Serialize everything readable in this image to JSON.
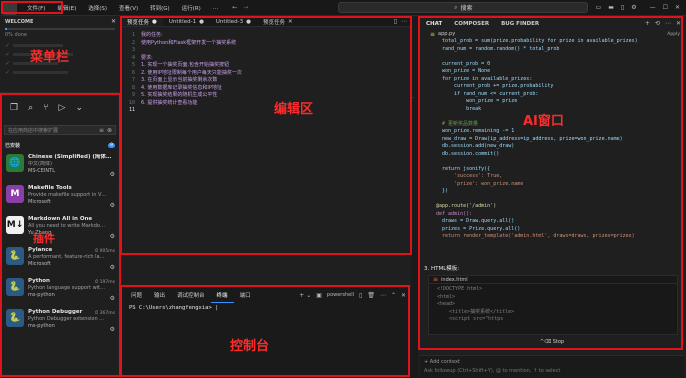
{
  "menu": {
    "items": [
      "文件(F)",
      "编辑(E)",
      "选择(S)",
      "查看(V)",
      "转到(G)",
      "运行(R)",
      "…"
    ],
    "search": "搜索"
  },
  "welcome": {
    "title": "WELCOME",
    "progress_label": "0% done",
    "progress_fraction": 0.0
  },
  "activity": [
    "explorer-icon",
    "search-icon",
    "source-control-icon",
    "run-debug-icon",
    "extensions-icon"
  ],
  "extensions": {
    "search_placeholder": "在应用商店中搜索扩展",
    "section_label": "已安装",
    "badge": "9",
    "items": [
      {
        "title": "Chinese (Simplified) (简体…",
        "desc": "中文(简体)",
        "publisher": "MS-CEINTL",
        "icon": "globe-icon",
        "color": "#2a7a3b",
        "glyph": "🌐",
        "meta": ""
      },
      {
        "title": "Makefile Tools",
        "desc": "Provide makefile support in V…",
        "publisher": "Microsoft",
        "icon": "makefile-icon",
        "color": "#8a3fa8",
        "glyph": "M",
        "meta": ""
      },
      {
        "title": "Markdown All in One",
        "desc": "All you need to write Markdo…",
        "publisher": "Yu Zhang",
        "icon": "markdown-icon",
        "color": "#f0f0f0",
        "glyph": "M↓",
        "meta": ""
      },
      {
        "title": "Pylance",
        "desc": "A performant, feature-rich la…",
        "publisher": "Microsoft",
        "icon": "python-icon",
        "color": "#2b5b84",
        "glyph": "🐍",
        "meta": "⏱ 905ms"
      },
      {
        "title": "Python",
        "desc": "Python language support wit…",
        "publisher": "ms-python",
        "icon": "python-icon",
        "color": "#2b5b84",
        "glyph": "🐍",
        "meta": "⏱ 197ms"
      },
      {
        "title": "Python Debugger",
        "desc": "Python Debugger extension …",
        "publisher": "ms-python",
        "icon": "python-debugger-icon",
        "color": "#2b5b84",
        "glyph": "🐍",
        "meta": "⏱ 367ms"
      }
    ]
  },
  "editor": {
    "tabs": [
      {
        "label": "预览任务",
        "dot": true
      },
      {
        "label": "Untitled-1",
        "dot": true
      },
      {
        "label": "Untitled-3",
        "dot": true
      },
      {
        "label": "预览任务",
        "dot": false
      }
    ],
    "lines": [
      "我的任务:",
      "使用Python和Flask框架开发一个抽奖系统",
      "",
      "要求:",
      "1. 实现一个抽奖页面,包含开始抽奖按钮",
      "2. 使用IP地址限制每个用户每天只能抽奖一次",
      "3. 在页面上显示当前抽奖剩余次数",
      "4. 使用数据库记录抽奖信息和IP地址",
      "5. 实现抽奖结果的随机生成公平性",
      "6. 提供抽奖统计查看功能",
      ""
    ]
  },
  "panel": {
    "tabs": [
      "问题",
      "输出",
      "调试控制台",
      "终端",
      "端口"
    ],
    "shell": "powershell",
    "prompt": "PS C:\\Users\\zhangfengxia> |"
  },
  "chat": {
    "tabs": [
      "CHAT",
      "COMPOSER",
      "BUG FINDER"
    ],
    "file": "app.py",
    "code_lines": [
      "  total_prob = sum(prize.probability for prize in available_prizes)",
      "  rand_num = random.random() * total_prob",
      "",
      "  current_prob = 0",
      "  won_prize = None",
      "  for prize in available_prizes:",
      "      current_prob += prize.probability",
      "      if rand_num <= current_prob:",
      "          won_prize = prize",
      "          break",
      "",
      "  # 更新奖品数量",
      "  won_prize.remaining -= 1",
      "  new_draw = Draw(ip_address=ip_address, prize=won_prize.name)",
      "  db.session.add(new_draw)",
      "  db.session.commit()",
      "",
      "  return jsonify({",
      "      'success': True,",
      "      'prize': won_prize.name",
      "  })",
      "",
      "@app.route('/admin')",
      "def admin():",
      "  draws = Draw.query.all()",
      "  prizes = Prize.query.all()",
      "  return render_template('admin.html', draws=draws, prizes=prizes)"
    ],
    "section": "3. HTML模板:",
    "html_file": "index.html",
    "html_lines": [
      "<!DOCTYPE html>",
      "<html>",
      "<head>",
      "    <title>抽奖系统</title>",
      "    <script src=\"https"
    ],
    "stop": "^⌫ Stop",
    "add_context": "+ Add context",
    "input_placeholder": "Ask followup (Ctrl+Shift+Y), @ to mention, ↑ to select"
  },
  "annotations": {
    "menu": "菜单栏",
    "editor": "编辑区",
    "ai": "AI窗口",
    "terminal": "控制台",
    "plugins": "插件"
  },
  "colors": {
    "highlight": "#e0121b",
    "accent": "#3794ff"
  }
}
